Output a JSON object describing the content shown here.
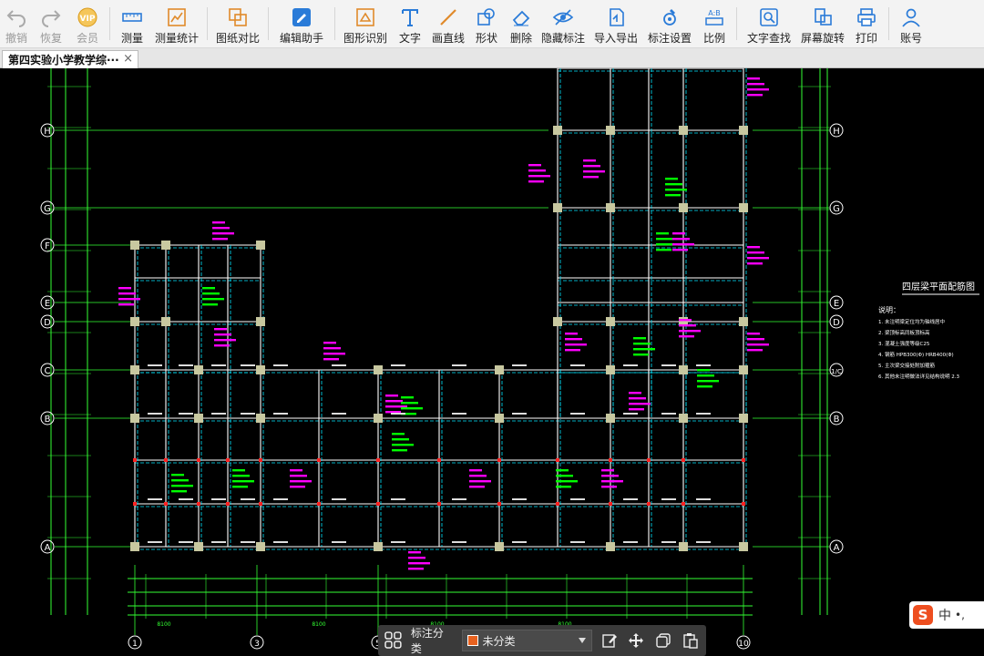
{
  "toolbar": {
    "items": [
      {
        "label": "撤销",
        "icon": "undo-icon",
        "disabled": true
      },
      {
        "label": "恢复",
        "icon": "redo-icon",
        "disabled": true
      },
      {
        "label": "会员",
        "icon": "vip-icon",
        "disabled": true
      },
      {
        "label": "测量",
        "icon": "measure-icon"
      },
      {
        "label": "测量统计",
        "icon": "measure-stats-icon"
      },
      {
        "label": "图纸对比",
        "icon": "compare-icon"
      },
      {
        "label": "编辑助手",
        "icon": "edit-assistant-icon"
      },
      {
        "label": "图形识别",
        "icon": "shape-recognize-icon"
      },
      {
        "label": "文字",
        "icon": "text-icon"
      },
      {
        "label": "画直线",
        "icon": "line-icon"
      },
      {
        "label": "形状",
        "icon": "shape-icon"
      },
      {
        "label": "删除",
        "icon": "eraser-icon"
      },
      {
        "label": "隐藏标注",
        "icon": "hide-icon"
      },
      {
        "label": "导入导出",
        "icon": "import-export-icon"
      },
      {
        "label": "标注设置",
        "icon": "annotation-settings-icon"
      },
      {
        "label": "比例",
        "icon": "scale-icon"
      },
      {
        "label": "文字查找",
        "icon": "text-search-icon"
      },
      {
        "label": "屏幕旋转",
        "icon": "rotate-icon"
      },
      {
        "label": "打印",
        "icon": "print-icon"
      },
      {
        "label": "账号",
        "icon": "account-icon"
      }
    ]
  },
  "tab": {
    "title": "第四实验小学教学综···",
    "close": "×"
  },
  "drawing": {
    "axis_rows": [
      "H",
      "G",
      "F",
      "E",
      "D",
      "C",
      "B",
      "A"
    ],
    "axis_rows_right": [
      "H",
      "G",
      "E",
      "D",
      "1/C",
      "B",
      "A"
    ],
    "axis_cols": [
      "1",
      "3",
      "5",
      "10"
    ],
    "title_block": "四层梁平面配筋图",
    "notes_title": "说明：",
    "notes": [
      "1. 未注明梁定位均为轴线居中",
      "2. 梁顶标高同板顶标高",
      "3. 混凝土强度等级C25",
      "4. 钢筋 HPB300(Φ) HRB400(Φ)",
      "5. 主次梁交接处附加箍筋",
      "6. 其他未注明做法详见结构说明 2.3"
    ],
    "dims_bottom": [
      "8100",
      "8100",
      "8100",
      "8100"
    ],
    "colors": {
      "axis": "#33ff33",
      "beam": "#ffffff",
      "beam_dash": "#00e5ff",
      "column": "#c8c8a0",
      "magenta": "#ff00ff",
      "green": "#00ff00",
      "red": "#ff2020"
    }
  },
  "bottom_bar": {
    "label": "标注分类",
    "selected": "未分类",
    "swatch_color": "#e8621f"
  },
  "ime": {
    "logo": "S",
    "lang": "中",
    "punct": "•,"
  }
}
